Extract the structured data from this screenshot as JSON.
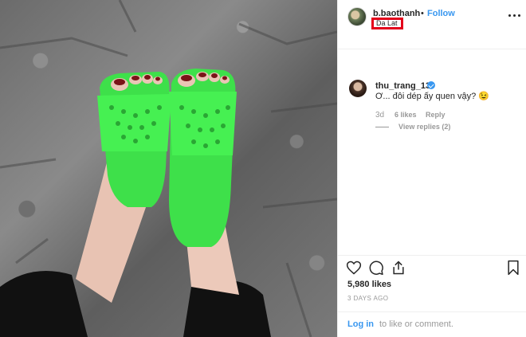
{
  "post": {
    "owner_username": "b.baothanh",
    "separator": "•",
    "follow_label": "Follow",
    "location": "Da Lat"
  },
  "comment": {
    "username": "thu_trang_13",
    "text": "Ơ... đôi dép ấy quen vậy? 😉",
    "time": "3d",
    "likes": "6 likes",
    "reply_label": "Reply",
    "view_replies": "View replies (2)"
  },
  "stats": {
    "likes": "5,980 likes",
    "date": "3 DAYS AGO"
  },
  "footer": {
    "login_label": "Log in",
    "rest_text": "to like or comment."
  },
  "colors": {
    "accent": "#3897f0",
    "highlight_box": "#e3001b",
    "slipper_green": "#3ee04a"
  },
  "icons": [
    "more-options-icon",
    "heart-icon",
    "comment-icon",
    "share-icon",
    "bookmark-icon",
    "verified-badge-icon"
  ]
}
